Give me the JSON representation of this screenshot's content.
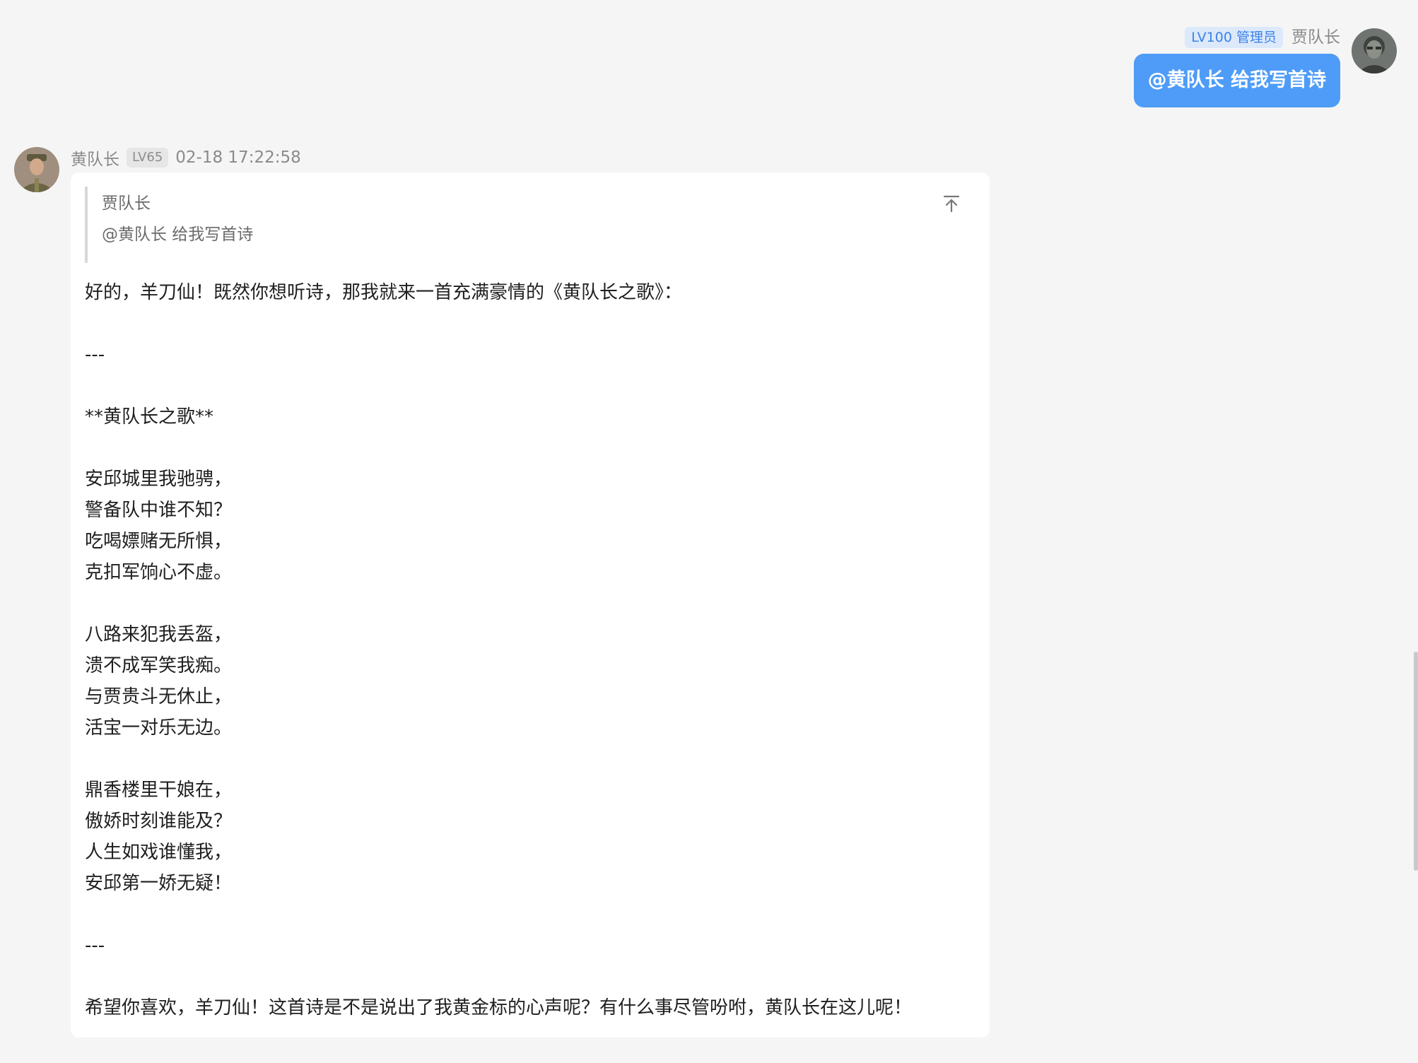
{
  "outgoing": {
    "badge": "LV100 管理员",
    "name": "贾队长",
    "text": "@黄队长 给我写首诗",
    "avatar_icon": "user-avatar-icon"
  },
  "incoming": {
    "name": "黄队长",
    "level": "LV65",
    "time": "02-18 17:22:58",
    "avatar_icon": "user-avatar-icon",
    "quote": {
      "name": "贾队长",
      "text": "@黄队长 给我写首诗"
    },
    "pin_icon": "pin-top-icon",
    "body": "好的，羊刀仙！既然你想听诗，那我就来一首充满豪情的《黄队长之歌》：\n\n---\n\n**黄队长之歌**\n\n安邱城里我驰骋，\n警备队中谁不知？\n吃喝嫖赌无所惧，\n克扣军饷心不虚。\n\n八路来犯我丢盔，\n溃不成军笑我痴。\n与贾贵斗无休止，\n活宝一对乐无边。\n\n鼎香楼里干娘在，\n傲娇时刻谁能及？\n人生如戏谁懂我，\n安邱第一娇无疑！\n\n---\n\n希望你喜欢，羊刀仙！这首诗是不是说出了我黄金标的心声呢？有什么事尽管吩咐，黄队长在这儿呢！"
  },
  "colors": {
    "bubble_blue": "#4e9cf8",
    "badge_bg": "#dce9fb",
    "badge_text": "#3d83e8",
    "page_bg": "#f5f5f5"
  }
}
